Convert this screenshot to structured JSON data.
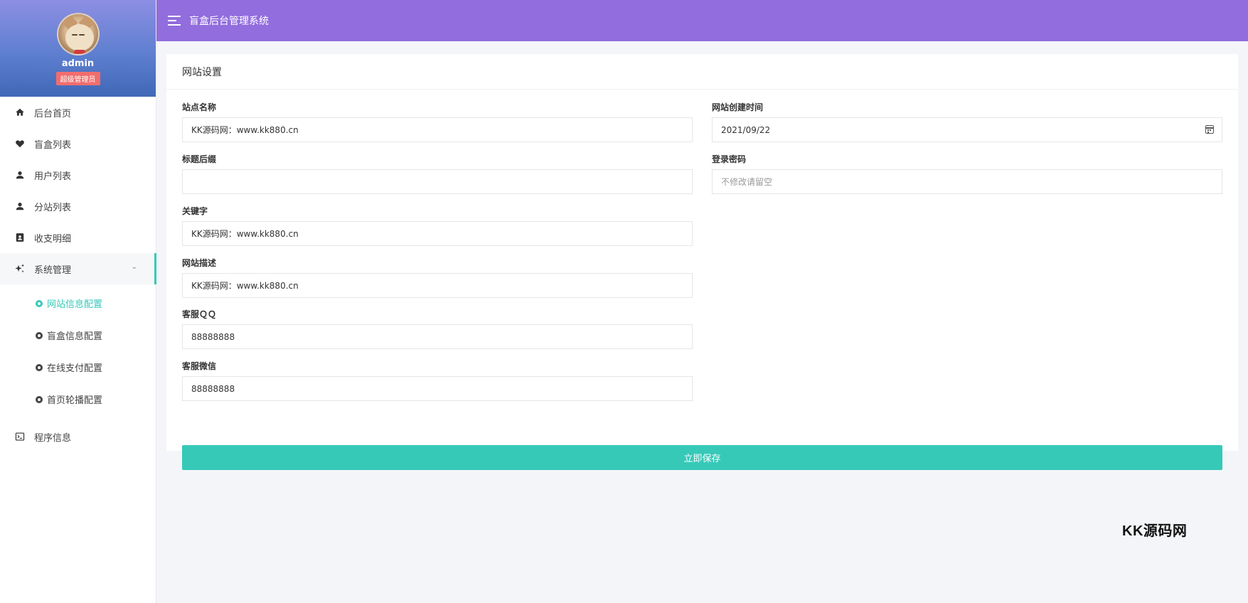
{
  "profile": {
    "name": "admin",
    "role": "超级管理员"
  },
  "menu": {
    "home": "后台首页",
    "blindbox": "盲盒列表",
    "users": "用户列表",
    "substations": "分站列表",
    "finance": "收支明细",
    "system": "系统管理",
    "program": "程序信息"
  },
  "submenu": {
    "site": "网站信息配置",
    "box": "盲盒信息配置",
    "pay": "在线支付配置",
    "banner": "首页轮播配置"
  },
  "topbar": {
    "title": "盲盒后台管理系统"
  },
  "card": {
    "title": "网站设置"
  },
  "form": {
    "site_name": {
      "label": "站点名称",
      "value": "KK源码网：www.kk880.cn"
    },
    "title_suffix": {
      "label": "标题后缀",
      "value": ""
    },
    "keywords": {
      "label": "关键字",
      "value": "KK源码网：www.kk880.cn"
    },
    "description": {
      "label": "网站描述",
      "value": "KK源码网：www.kk880.cn"
    },
    "qq": {
      "label": "客服ＱＱ",
      "value": "88888888"
    },
    "wechat": {
      "label": "客服微信",
      "value": "88888888"
    },
    "created": {
      "label": "网站创建时间",
      "value": "2021/09/22"
    },
    "password": {
      "label": "登录密码",
      "placeholder": "不修改请留空"
    },
    "save_label": "立即保存"
  },
  "watermark": "KK源码网",
  "colors": {
    "topbar": "#926ddd",
    "accent": "#36c9b8",
    "badge": "#f26d6d"
  }
}
